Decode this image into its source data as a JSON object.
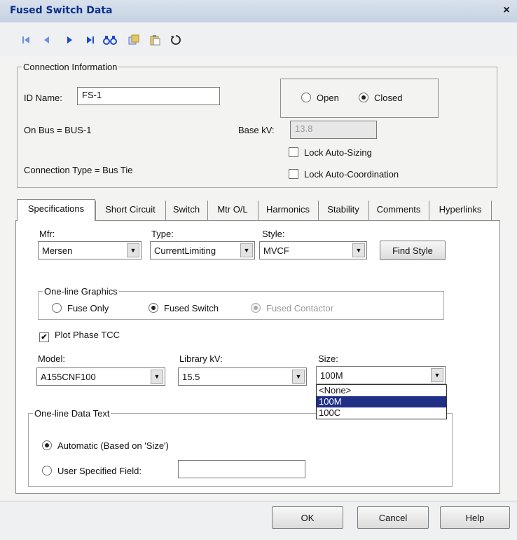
{
  "window": {
    "title": "Fused Switch Data",
    "close_glyph": "×"
  },
  "toolbar": {
    "icons": [
      "first-icon",
      "previous-icon",
      "next-icon",
      "last-icon",
      "find-icon",
      "copy-icon",
      "paste-icon",
      "undo-icon"
    ]
  },
  "connection": {
    "legend": "Connection Information",
    "id_label": "ID Name:",
    "id_value": "FS-1",
    "open_label": "Open",
    "closed_label": "Closed",
    "on_bus": "On Bus = BUS-1",
    "base_kv_label": "Base kV:",
    "base_kv_value": "13.8",
    "lock_auto_sizing": "Lock Auto-Sizing",
    "lock_auto_coord": "Lock Auto-Coordination",
    "connection_type": "Connection Type = Bus Tie"
  },
  "tabs": [
    "Specifications",
    "Short Circuit",
    "Switch",
    "Mtr O/L",
    "Harmonics",
    "Stability",
    "Comments",
    "Hyperlinks"
  ],
  "spec": {
    "mfr_label": "Mfr:",
    "mfr_value": "Mersen",
    "type_label": "Type:",
    "type_value": "CurrentLimiting",
    "style_label": "Style:",
    "style_value": "MVCF",
    "find_style": "Find Style",
    "graphics_legend": "One-line Graphics",
    "fuse_only": "Fuse Only",
    "fused_switch": "Fused Switch",
    "fused_contactor": "Fused Contactor",
    "plot_phase_tcc": "Plot Phase TCC",
    "model_label": "Model:",
    "model_value": "A155CNF100",
    "library_kv_label": "Library kV:",
    "library_kv_value": "15.5",
    "size_label": "Size:",
    "size_value": "100M",
    "size_options": [
      "<None>",
      "100M",
      "100C"
    ],
    "size_selected_index": 1,
    "datatext_legend": "One-line Data Text",
    "automatic": "Automatic (Based on 'Size')",
    "user_specified": "User Specified Field:",
    "user_specified_value": ""
  },
  "footer": {
    "ok": "OK",
    "cancel": "Cancel",
    "help": "Help"
  },
  "colors": {
    "title_text": "#0b2f8a",
    "selection": "#1f2f86",
    "toolbar_icon": "#2a56c8"
  }
}
